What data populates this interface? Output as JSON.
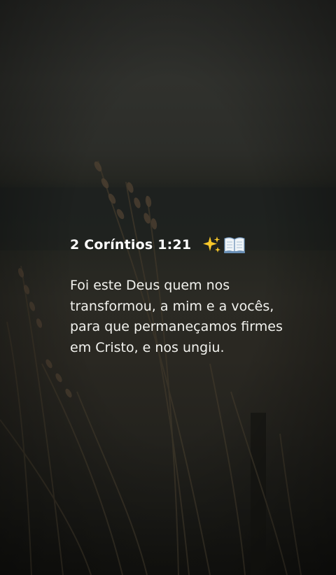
{
  "verse": {
    "reference": "2 Coríntios 1:21",
    "emoji_icons": [
      "sparkles-icon",
      "open-book-icon"
    ],
    "text": "Foi este Deus quem nos\ntransformou, a mim e a vocês,\npara que permaneçamos firmes\nem Cristo, e nos ungiu."
  }
}
